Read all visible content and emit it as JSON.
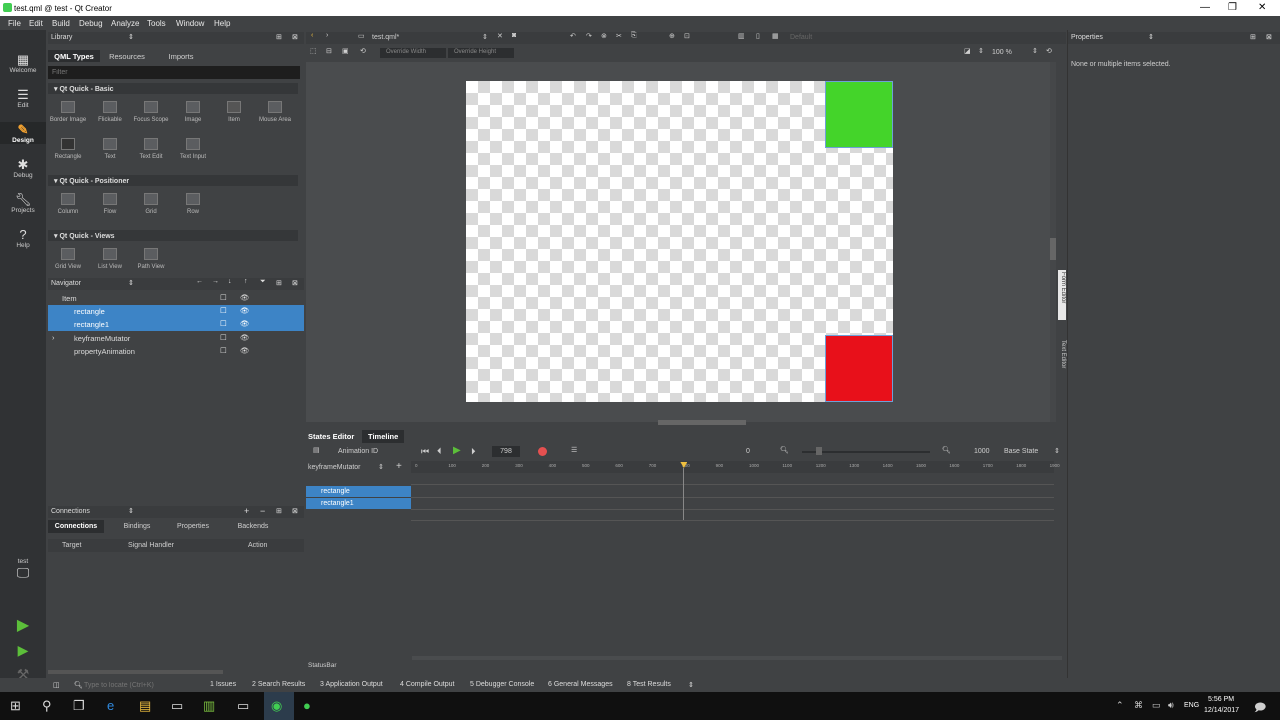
{
  "window": {
    "title": "test.qml @ test - Qt Creator"
  },
  "menu": [
    "File",
    "Edit",
    "Build",
    "Debug",
    "Analyze",
    "Tools",
    "Window",
    "Help"
  ],
  "modes": [
    {
      "label": "Welcome",
      "icon": "grid-icon"
    },
    {
      "label": "Edit",
      "icon": "document-icon"
    },
    {
      "label": "Design",
      "icon": "pencil-icon"
    },
    {
      "label": "Debug",
      "icon": "bug-icon"
    },
    {
      "label": "Projects",
      "icon": "wrench-icon"
    },
    {
      "label": "Help",
      "icon": "help-icon"
    }
  ],
  "kit": {
    "label": "test"
  },
  "library": {
    "header": "Library",
    "tabs": [
      "QML Types",
      "Resources",
      "Imports"
    ],
    "filter_placeholder": "Filter",
    "categories": [
      {
        "name": "Qt Quick - Basic",
        "items": [
          "Border Image",
          "Flickable",
          "Focus Scope",
          "Image",
          "Item",
          "Mouse Area",
          "Rectangle",
          "Text",
          "Text Edit",
          "Text Input"
        ]
      },
      {
        "name": "Qt Quick - Positioner",
        "items": [
          "Column",
          "Flow",
          "Grid",
          "Row"
        ]
      },
      {
        "name": "Qt Quick - Views",
        "items": [
          "Grid View",
          "List View",
          "Path View"
        ]
      }
    ]
  },
  "navigator": {
    "header": "Navigator",
    "rows": [
      {
        "label": "Item",
        "selected": false
      },
      {
        "label": "rectangle",
        "selected": true
      },
      {
        "label": "rectangle1",
        "selected": true
      },
      {
        "label": "keyframeMutator",
        "selected": false
      },
      {
        "label": "propertyAnimation",
        "selected": false
      }
    ]
  },
  "connections": {
    "header": "Connections",
    "tabs": [
      "Connections",
      "Bindings",
      "Properties",
      "Backends"
    ],
    "columns": [
      "Target",
      "Signal Handler",
      "Action"
    ]
  },
  "editor": {
    "file_tab": "test.qml*",
    "override_width": "Override Width",
    "override_height": "Override Height",
    "state": "Default",
    "zoom": "100 %",
    "side_tabs": [
      "Form Editor",
      "Text Editor"
    ]
  },
  "bottom_tabs": [
    "States Editor",
    "Timeline"
  ],
  "timeline": {
    "animation_id_label": "Animation ID",
    "current_frame": "798",
    "start": "0",
    "end": "1000",
    "state": "Base State",
    "mutator": "keyframeMutator",
    "ticks": [
      "0",
      "100",
      "200",
      "300",
      "400",
      "500",
      "600",
      "700",
      "800",
      "900",
      "1000",
      "1100",
      "1200",
      "1300",
      "1400",
      "1500",
      "1600",
      "1700",
      "1800",
      "1900"
    ],
    "playhead_fraction": 0.42,
    "tracks": [
      "rectangle",
      "rectangle1"
    ]
  },
  "properties": {
    "header": "Properties",
    "message": "None or multiple items selected."
  },
  "statusbar_label": "StatusBar",
  "status": {
    "locate_placeholder": "Type to locate (Ctrl+K)",
    "panes": [
      "1  Issues",
      "2  Search Results",
      "3  Application Output",
      "4  Compile Output",
      "5  Debugger Console",
      "6  General Messages",
      "8  Test Results"
    ]
  },
  "taskbar": {
    "lang": "ENG",
    "time": "5:56 PM",
    "date": "12/14/2017"
  },
  "colors": {
    "green_rect": "#44d42a",
    "red_rect": "#e8101a",
    "selection": "#3d84c6"
  }
}
